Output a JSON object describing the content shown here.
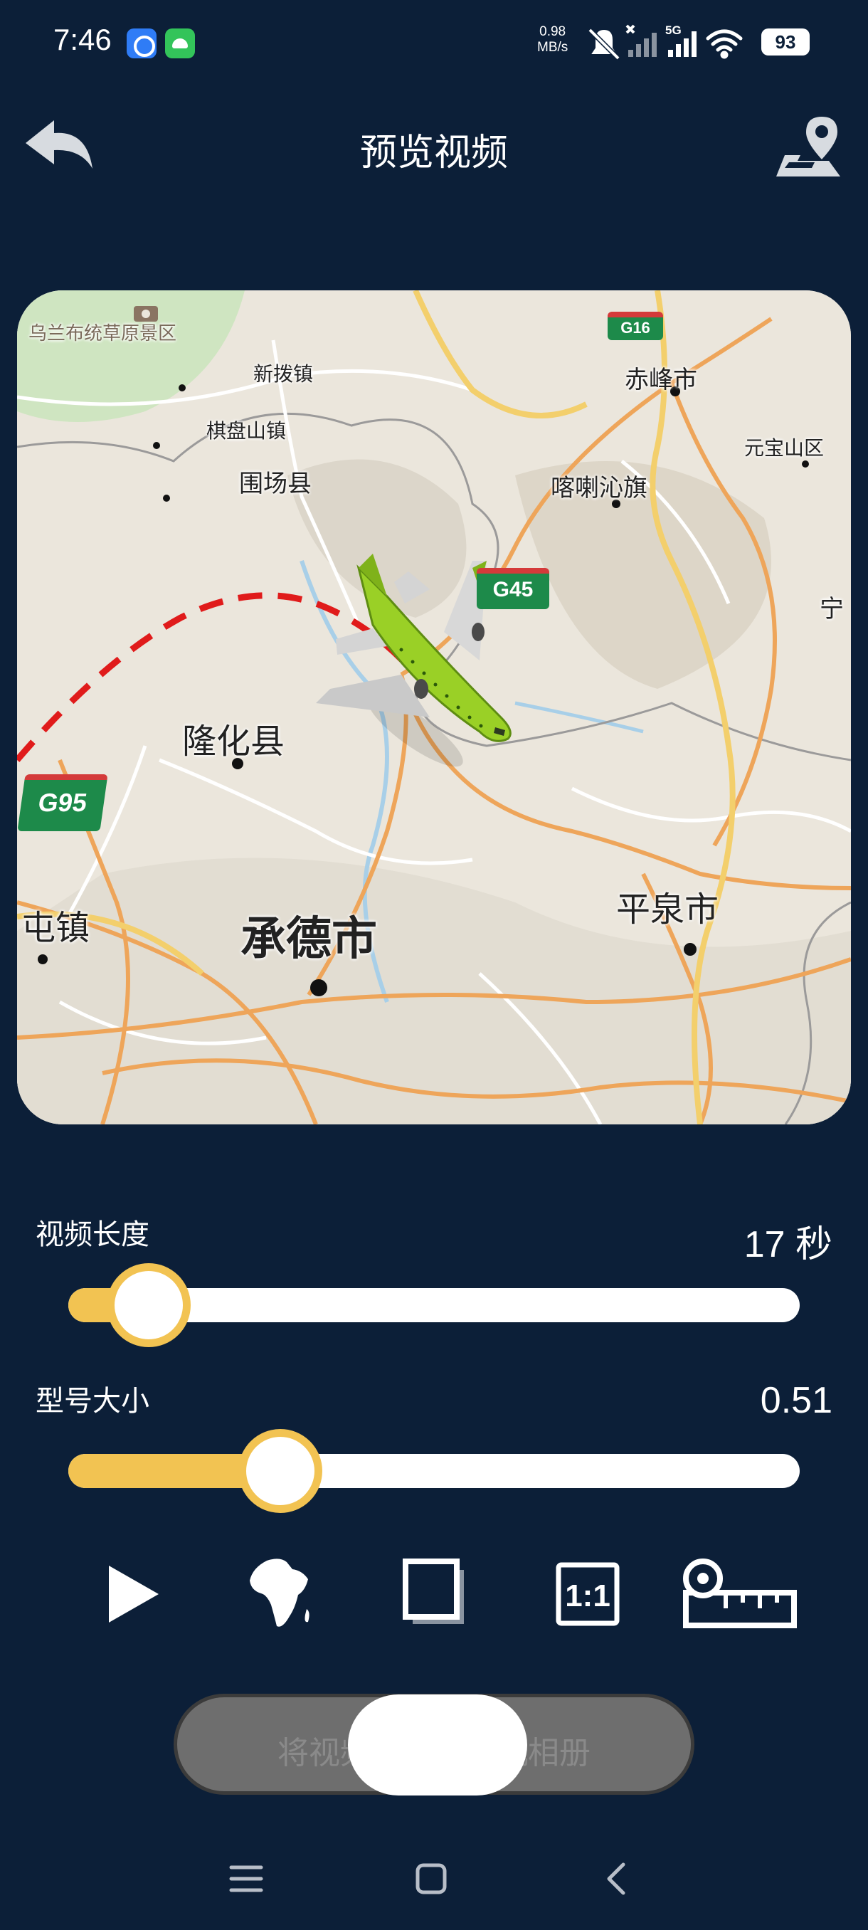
{
  "status_bar": {
    "time": "7:46",
    "net_speed_value": "0.98",
    "net_speed_unit": "MB/s",
    "network": "5G",
    "battery": "93",
    "icons": [
      "browser-app-icon",
      "android-app-icon",
      "mute-bell-icon",
      "no-signal-icon",
      "signal-5g-icon",
      "wifi-icon",
      "battery-icon"
    ]
  },
  "header": {
    "title": "预览视频",
    "back_icon": "back-arrow-icon",
    "map_icon": "map-pin-icon"
  },
  "map": {
    "labels": {
      "scenic_area": "乌兰布统草原景区",
      "xinbo": "新拨镇",
      "qipanshan": "棋盘山镇",
      "weichang": "围场县",
      "chifeng": "赤峰市",
      "yuanbaoshan": "元宝山区",
      "harqin": "喀喇沁旗",
      "ning": "宁",
      "longhua": "隆化县",
      "tun": "屯镇",
      "chengde": "承德市",
      "pingquan": "平泉市"
    },
    "shields": {
      "g16": "G16",
      "g45": "G45",
      "g95": "G95"
    },
    "route_color": "#e01b1b",
    "plane_color": "#9ad026"
  },
  "controls": {
    "video_length": {
      "label": "视频长度",
      "value": "17 秒",
      "fraction": 0.11
    },
    "model_size": {
      "label": "型号大小",
      "value": "0.51",
      "fraction": 0.29
    },
    "accent_color": "#f2c352"
  },
  "toolbar": [
    "play-icon",
    "africa-continent-icon",
    "frame-square-icon",
    "aspect-ratio-1-1-icon",
    "ruler-icon"
  ],
  "toolbar_ratio_text": "1:1",
  "save_button": {
    "label": "将视频保存到相机相册"
  },
  "nav_bar": [
    "menu-icon",
    "home-square-icon",
    "back-chevron-icon"
  ]
}
